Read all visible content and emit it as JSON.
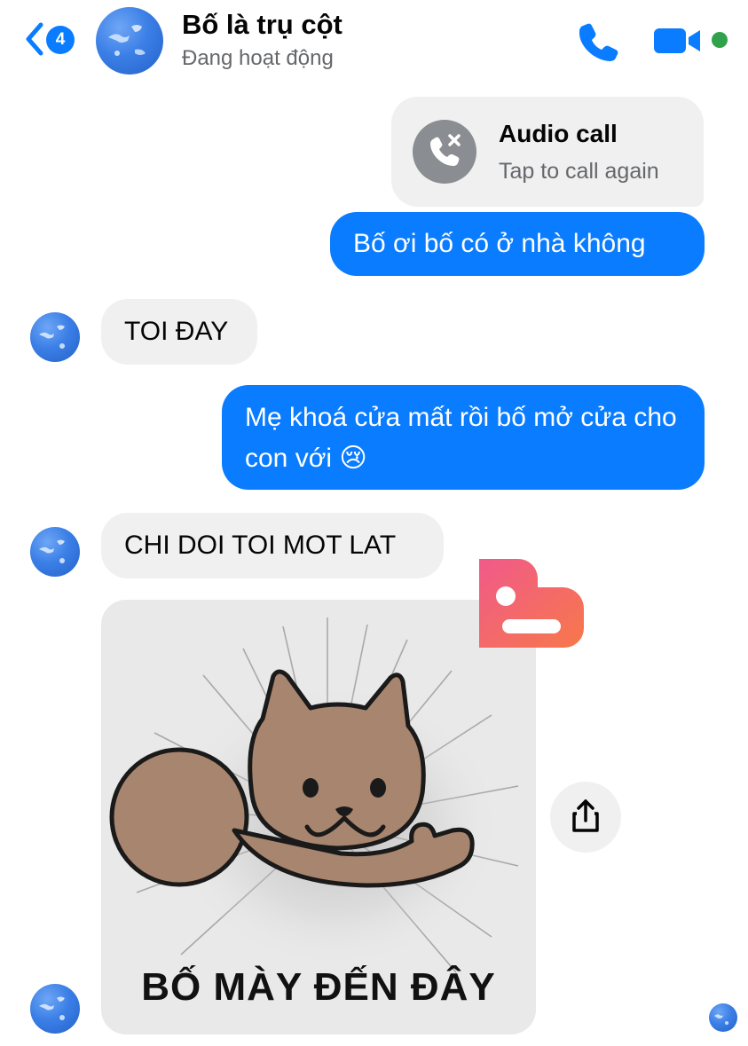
{
  "header": {
    "unread_count": "4",
    "contact_name": "Bố là trụ cột",
    "status": "Đang hoạt động"
  },
  "colors": {
    "accent_blue": "#0a7cff",
    "incoming_bubble": "#f0f0f0",
    "online_green": "#31a24c"
  },
  "icons": {
    "back": "chevron-left-icon",
    "call": "phone-icon",
    "video": "video-camera-icon",
    "missed_call": "missed-call-icon",
    "share": "share-icon"
  },
  "messages": [
    {
      "sender": "me",
      "type": "call",
      "title": "Audio call",
      "subtitle": "Tap to call again"
    },
    {
      "sender": "me",
      "type": "text",
      "text": "Bố ơi bố có ở nhà không"
    },
    {
      "sender": "contact",
      "type": "text",
      "text": "TOI ĐAY"
    },
    {
      "sender": "me",
      "type": "text",
      "text": "Mẹ khoá cửa mất rồi bố mở cửa cho con với 😢"
    },
    {
      "sender": "contact",
      "type": "text",
      "text": "CHI DOI TOI MOT LAT"
    },
    {
      "sender": "contact",
      "type": "sticker",
      "caption": "BỐ MÀY ĐẾN ĐÂY"
    }
  ]
}
